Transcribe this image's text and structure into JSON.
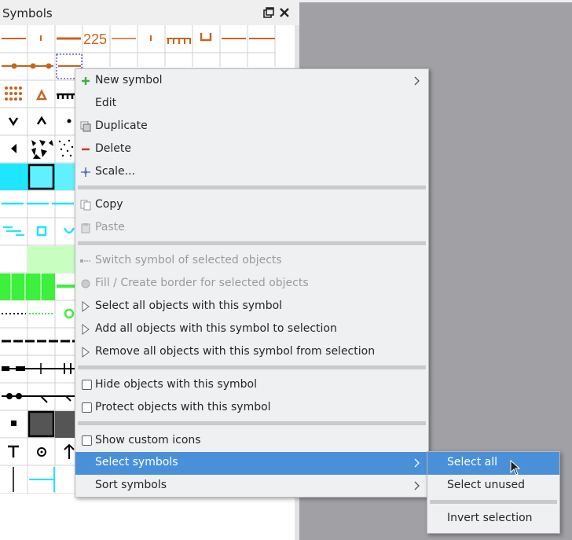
{
  "panel": {
    "title": "Symbols",
    "float_icon": "float-icon",
    "close_icon": "close-icon"
  },
  "context_menu": {
    "items": [
      {
        "label": "New symbol",
        "icon": "plus-icon",
        "submenu": true,
        "enabled": true
      },
      {
        "label": "Edit",
        "enabled": true
      },
      {
        "label": "Duplicate",
        "icon": "duplicate-icon",
        "enabled": true
      },
      {
        "label": "Delete",
        "icon": "minus-icon",
        "enabled": true
      },
      {
        "label": "Scale...",
        "icon": "scale-icon",
        "enabled": true
      },
      {
        "label": "Copy",
        "icon": "copy-icon",
        "enabled": true
      },
      {
        "label": "Paste",
        "icon": "paste-icon",
        "enabled": false
      },
      {
        "label": "Switch symbol of selected objects",
        "icon": "switch-symbol-icon",
        "enabled": false
      },
      {
        "label": "Fill / Create border for selected objects",
        "icon": "fill-border-icon",
        "enabled": false
      },
      {
        "label": "Select all objects with this symbol",
        "icon": "cursor-icon",
        "enabled": true
      },
      {
        "label": "Add all objects with this symbol to selection",
        "icon": "cursor-icon",
        "enabled": true
      },
      {
        "label": "Remove all objects with this symbol from selection",
        "icon": "cursor-icon",
        "enabled": true
      },
      {
        "label": "Hide objects with this symbol",
        "checkbox": true,
        "checked": false
      },
      {
        "label": "Protect objects with this symbol",
        "checkbox": true,
        "checked": false
      },
      {
        "label": "Show custom icons",
        "checkbox": true,
        "checked": false
      },
      {
        "label": "Select symbols",
        "submenu": true,
        "highlighted": true
      },
      {
        "label": "Sort symbols",
        "submenu": true
      }
    ]
  },
  "submenu": {
    "items": [
      {
        "label": "Select all",
        "highlighted": true
      },
      {
        "label": "Select unused"
      },
      {
        "label": "Invert selection"
      }
    ]
  },
  "symbol_grid": {
    "visible_label": "225",
    "colors": {
      "orange": "#c8641c",
      "cyan": "#1ee6ff",
      "green": "#3cf03c",
      "black": "#000000",
      "gray": "#555555"
    }
  },
  "colors": {
    "highlight": "#4a90d9",
    "menu_bg": "#eff0f1",
    "dark_area": "#a0a0a5"
  }
}
